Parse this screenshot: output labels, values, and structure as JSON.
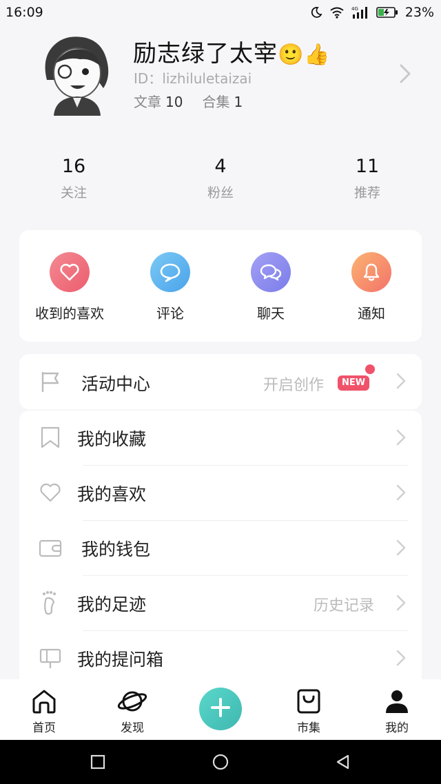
{
  "status_bar": {
    "time": "16:09",
    "network": "4G",
    "battery": "23%"
  },
  "profile": {
    "username": "励志绿了太宰",
    "emoji": "🙂👍",
    "id_label": "ID：",
    "id_value": "lizhiluletaizai",
    "articles_label": "文章",
    "articles_count": "10",
    "collections_label": "合集",
    "collections_count": "1"
  },
  "stats": [
    {
      "value": "16",
      "label": "关注"
    },
    {
      "value": "4",
      "label": "粉丝"
    },
    {
      "value": "11",
      "label": "推荐"
    }
  ],
  "quick_actions": [
    {
      "label": "收到的喜欢",
      "icon": "heart-icon",
      "color": "#f0707e"
    },
    {
      "label": "评论",
      "icon": "comment-icon",
      "color": "#5fb3ef"
    },
    {
      "label": "聊天",
      "icon": "chat-icon",
      "color": "#8e8ef0"
    },
    {
      "label": "通知",
      "icon": "bell-icon",
      "color": "#f89a6c"
    }
  ],
  "activity": {
    "label": "活动中心",
    "hint": "开启创作",
    "badge": "NEW",
    "icon": "flag-icon"
  },
  "menu": [
    {
      "label": "我的收藏",
      "hint": "",
      "icon": "bookmark-icon"
    },
    {
      "label": "我的喜欢",
      "hint": "",
      "icon": "heart-outline-icon"
    },
    {
      "label": "我的钱包",
      "hint": "",
      "icon": "wallet-icon"
    },
    {
      "label": "我的足迹",
      "hint": "历史记录",
      "icon": "footprint-icon"
    },
    {
      "label": "我的提问箱",
      "hint": "",
      "icon": "question-box-icon"
    }
  ],
  "bottom_nav": [
    {
      "label": "首页",
      "icon": "home-icon"
    },
    {
      "label": "发现",
      "icon": "planet-icon"
    },
    {
      "label": "",
      "icon": "plus-icon"
    },
    {
      "label": "市集",
      "icon": "shopping-bag-icon"
    },
    {
      "label": "我的",
      "icon": "person-icon"
    }
  ],
  "colors": {
    "accent": "#4cc7be",
    "badge": "#f0526a",
    "background": "#f6f6f8"
  }
}
